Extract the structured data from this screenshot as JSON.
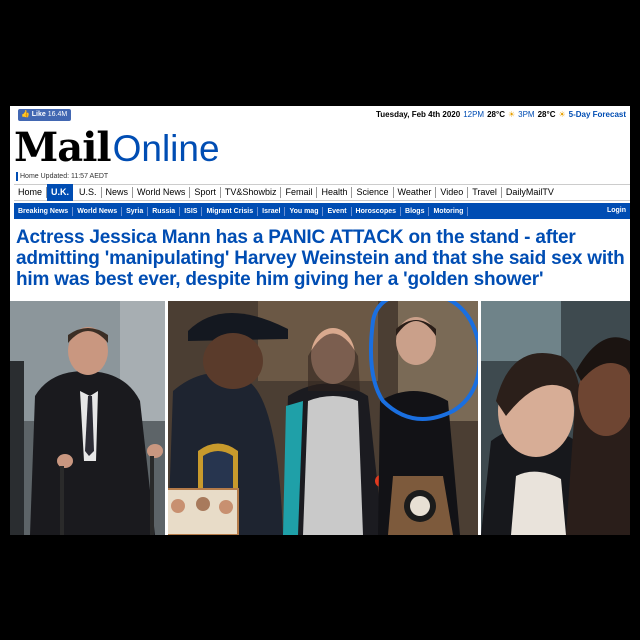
{
  "topbar": {
    "fb_like_label": "Like",
    "fb_like_count": "16.4M",
    "date": "Tuesday, Feb 4th 2020",
    "forecast": [
      {
        "time": "12PM",
        "temp": "28°C"
      },
      {
        "time": "3PM",
        "temp": "28°C"
      }
    ],
    "forecast_link": "5-Day Forecast"
  },
  "logo": {
    "mail": "Mail",
    "online": "Online"
  },
  "updated": "Home Updated: 11:57 AEDT",
  "nav_primary": [
    {
      "label": "Home",
      "active": false
    },
    {
      "label": "U.K.",
      "active": true
    },
    {
      "label": "U.S.",
      "active": false
    },
    {
      "label": "News",
      "active": false
    },
    {
      "label": "World News",
      "active": false
    },
    {
      "label": "Sport",
      "active": false
    },
    {
      "label": "TV&Showbiz",
      "active": false
    },
    {
      "label": "Femail",
      "active": false
    },
    {
      "label": "Health",
      "active": false
    },
    {
      "label": "Science",
      "active": false
    },
    {
      "label": "Weather",
      "active": false
    },
    {
      "label": "Video",
      "active": false
    },
    {
      "label": "Travel",
      "active": false
    },
    {
      "label": "DailyMailTV",
      "active": false
    }
  ],
  "nav_secondary": [
    "Breaking News",
    "World News",
    "Syria",
    "Russia",
    "ISIS",
    "Migrant Crisis",
    "Israel",
    "You mag",
    "Event",
    "Horoscopes",
    "Blogs",
    "Motoring"
  ],
  "login_label": "Login",
  "headline": "Actress Jessica Mann has a PANIC ATTACK on the stand - after admitting 'manipulating' Harvey Weinstein and that she said sex with him was best ever, despite him giving her a 'golden shower'",
  "colors": {
    "brand_blue": "#004db3",
    "facebook_blue": "#4267b2",
    "annotation_circle": "#1a6fe0"
  },
  "icons": {
    "facebook_like": "thumbs-up-icon",
    "weather": "sun-cloud-icon"
  }
}
